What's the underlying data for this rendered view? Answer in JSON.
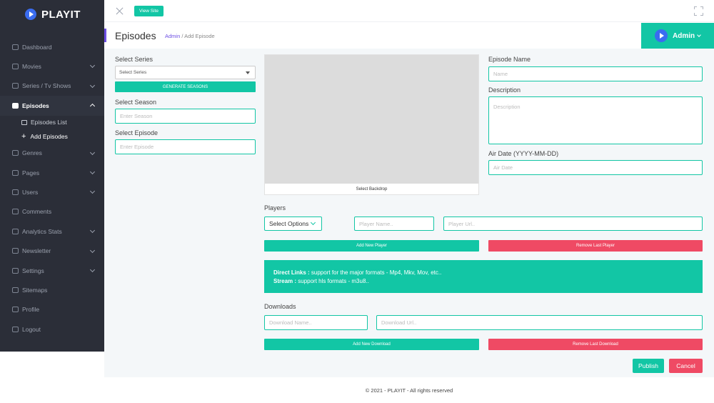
{
  "brand": {
    "name": "PLAYIT"
  },
  "sidebar": {
    "items": [
      {
        "label": "Dashboard",
        "icon": "dashboard-icon",
        "chevron": false
      },
      {
        "label": "Movies",
        "icon": "movie-icon",
        "chevron": true
      },
      {
        "label": "Series / Tv Shows",
        "icon": "tv-icon",
        "chevron": true
      },
      {
        "label": "Episodes",
        "icon": "episodes-icon",
        "chevron": true,
        "active": true
      },
      {
        "label": "Genres",
        "icon": "genres-icon",
        "chevron": true
      },
      {
        "label": "Pages",
        "icon": "pages-icon",
        "chevron": true
      },
      {
        "label": "Users",
        "icon": "users-icon",
        "chevron": true
      },
      {
        "label": "Comments",
        "icon": "comments-icon",
        "chevron": false
      },
      {
        "label": "Analytics Stats",
        "icon": "analytics-icon",
        "chevron": true
      },
      {
        "label": "Newsletter",
        "icon": "newsletter-icon",
        "chevron": true
      },
      {
        "label": "Settings",
        "icon": "gear-icon",
        "chevron": true
      },
      {
        "label": "Sitemaps",
        "icon": "sitemap-icon",
        "chevron": false
      },
      {
        "label": "Profile",
        "icon": "user-icon",
        "chevron": false
      },
      {
        "label": "Logout",
        "icon": "power-icon",
        "chevron": false
      }
    ],
    "episodes_sub": {
      "list": "Episodes List",
      "add": "Add Episodes"
    }
  },
  "topbar": {
    "view_site": "View Site"
  },
  "header": {
    "title": "Episodes",
    "breadcrumb_link": "Admin",
    "breadcrumb_sep": "/",
    "breadcrumb_current": "Add Episode",
    "admin_label": "Admin"
  },
  "form": {
    "series_label": "Select Series",
    "series_select": "Select Series",
    "generate_seasons": "GENERATE SEASONS",
    "season_label": "Select Season",
    "season_placeholder": "Enter Season",
    "episode_label": "Select Episode",
    "episode_placeholder": "Enter Episode",
    "backdrop_label": "Select Backdrop",
    "name_label": "Episode Name",
    "name_placeholder": "Name",
    "description_label": "Description",
    "description_placeholder": "Description",
    "airdate_label": "Air Date (YYYY-MM-DD)",
    "airdate_placeholder": "Air Date",
    "players_label": "Players",
    "select_options": "Select Options",
    "player_name_placeholder": "Player Name..",
    "player_url_placeholder": "Player Url..",
    "add_player": "Add New Player",
    "remove_player": "Remove Last Player",
    "info_direct_title": "Direct Links :",
    "info_direct_text": " support for the major formats - Mp4, Mkv, Mov, etc..",
    "info_stream_title": "Stream :",
    "info_stream_text": " support hls formats - m3u8..",
    "downloads_label": "Downloads",
    "download_name_placeholder": "Download Name..",
    "download_url_placeholder": "Download Url..",
    "add_download": "Add New Download",
    "remove_download": "Remove Last Download",
    "publish": "Publish",
    "cancel": "Cancel"
  },
  "footer": {
    "text": "© 2021 - PLAYIT - All rights reserved"
  },
  "colors": {
    "accent": "#12c6a5",
    "danger": "#ef4a64",
    "sidebar": "#2b2e38",
    "brand_blue": "#3a6cf0"
  }
}
